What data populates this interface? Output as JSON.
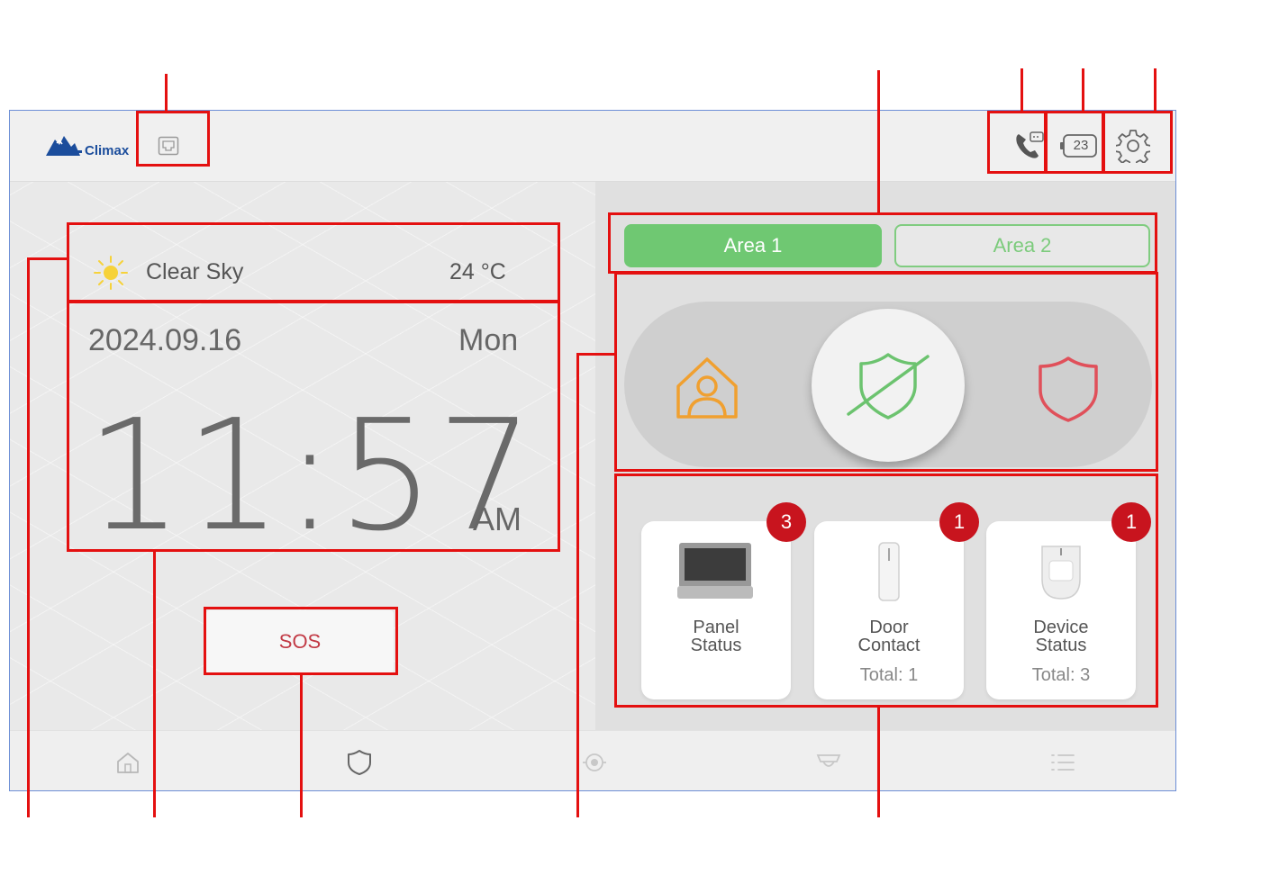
{
  "header": {
    "logo_text": "Climax",
    "icons": [
      "network-icon",
      "phone-icon",
      "battery-icon",
      "settings-icon"
    ],
    "battery_level": "23"
  },
  "weather": {
    "condition": "Clear Sky",
    "temperature": "24 °C"
  },
  "datetime": {
    "date": "2024.09.16",
    "weekday": "Mon",
    "time": "11:57",
    "ampm": "AM"
  },
  "sos": {
    "label": "SOS"
  },
  "areas": {
    "tabs": [
      "Area 1",
      "Area 2"
    ],
    "selected": "Area 1"
  },
  "arm_modes": [
    "home-arm",
    "disarm",
    "away-arm"
  ],
  "active_arm_mode": "disarm",
  "status_cards": [
    {
      "title_line1": "Panel",
      "title_line2": "Status",
      "total": "",
      "badge": "3"
    },
    {
      "title_line1": "Door",
      "title_line2": "Contact",
      "total": "Total: 1",
      "badge": "1"
    },
    {
      "title_line1": "Device",
      "title_line2": "Status",
      "total": "Total: 3",
      "badge": "1"
    }
  ],
  "bottom_nav": [
    "home-icon",
    "shield-icon",
    "camera-icon",
    "cctv-icon",
    "list-icon"
  ],
  "colors": {
    "accent_green": "#6fc872",
    "home_arm_orange": "#f0a030",
    "away_arm_red": "#e0505a",
    "badge_red": "#c8141e",
    "annotation_red": "#e41010"
  }
}
